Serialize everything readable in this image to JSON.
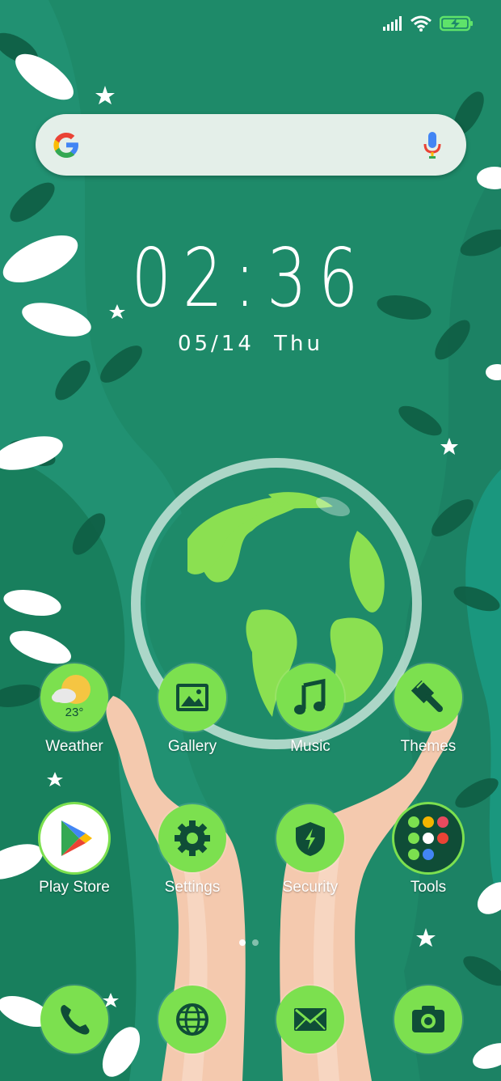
{
  "colors": {
    "accent": "#7ce04f",
    "icon_dark": "#0f4d37",
    "bg": "#1f8a6a",
    "battery": "#5fe36a"
  },
  "status_bar": {
    "signal_icon": "signal-icon",
    "wifi_icon": "wifi-icon",
    "battery_icon": "battery-charging-icon"
  },
  "search": {
    "logo": "google-logo",
    "mic_icon": "mic-icon"
  },
  "clock": {
    "time": "02:36",
    "date": "05/14",
    "day": "Thu"
  },
  "weather": {
    "temp": "23°"
  },
  "apps": {
    "weather": "Weather",
    "gallery": "Gallery",
    "music": "Music",
    "themes": "Themes",
    "play_store": "Play Store",
    "settings": "Settings",
    "security": "Security",
    "tools": "Tools"
  },
  "dock": [
    "phone-icon",
    "browser-icon",
    "mail-icon",
    "camera-icon"
  ],
  "page_indicator": {
    "pages": 2,
    "current": 1
  }
}
